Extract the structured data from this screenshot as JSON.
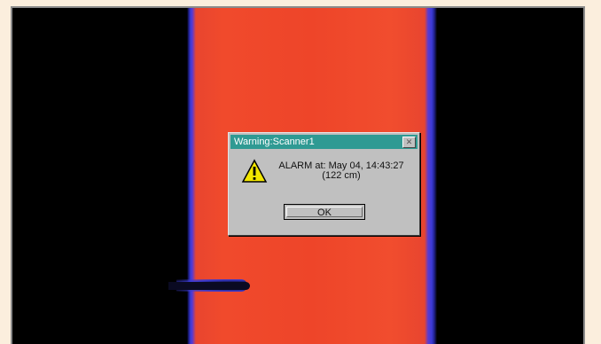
{
  "dialog": {
    "title": "Warning:Scanner1",
    "close_symbol": "✕",
    "icon": "warning-icon",
    "message_line1": "ALARM at: May 04, 14:43:27",
    "message_line2": "(122 cm)",
    "ok_label": "OK"
  },
  "colors": {
    "background": "#fbeedd",
    "band": "#f04a2c",
    "title_bar": "#2f9a93",
    "dialog": "#c0c0c0"
  }
}
